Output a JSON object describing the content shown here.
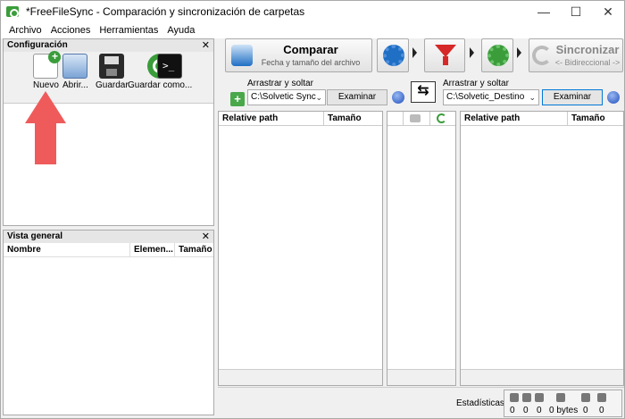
{
  "window": {
    "title": "*FreeFileSync - Comparación y sincronización de carpetas"
  },
  "menu": [
    "Archivo",
    "Acciones",
    "Herramientas",
    "Ayuda"
  ],
  "config_panel": {
    "title": "Configuración",
    "tools": [
      {
        "label": "Nuevo",
        "icon": "new-file-icon"
      },
      {
        "label": "Abrir...",
        "icon": "open-icon"
      },
      {
        "label": "Guardar",
        "icon": "save-icon"
      },
      {
        "label": "Guardar como...",
        "icon": "save-as-batch-icon"
      }
    ]
  },
  "overview_panel": {
    "title": "Vista general",
    "columns": [
      "Nombre",
      "Elemen...",
      "Tamaño"
    ]
  },
  "toolbar": {
    "compare": {
      "title": "Comparar",
      "subtitle": "Fecha y tamaño del archivo"
    },
    "sync": {
      "title": "Sincronizar",
      "subtitle": "<- Bidireccional ->"
    }
  },
  "left_folder": {
    "drag_label": "Arrastrar y soltar",
    "path": "C:\\Solvetic Sync",
    "browse_label": "Examinar"
  },
  "right_folder": {
    "drag_label": "Arrastrar y soltar",
    "path": "C:\\Solvetic_Destino",
    "browse_label": "Examinar"
  },
  "left_grid": {
    "columns": [
      "Relative path",
      "Tamaño"
    ]
  },
  "right_grid": {
    "columns": [
      "Relative path",
      "Tamaño"
    ]
  },
  "status": {
    "label": "Estadísticas:",
    "values": [
      "0",
      "0",
      "0",
      "0 bytes",
      "0",
      "0"
    ]
  },
  "colors": {
    "accent_arrow": "#ef5b5b",
    "compare_blue": "#1f6fc4",
    "filter_red": "#d62828",
    "sync_green": "#3a9d3a"
  }
}
